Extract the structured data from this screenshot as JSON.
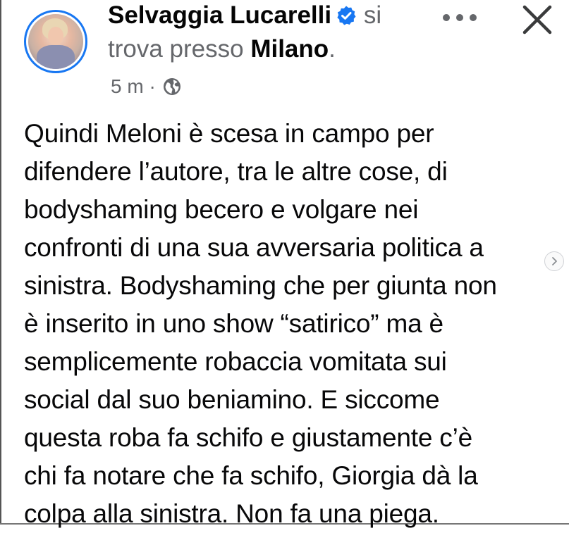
{
  "post": {
    "author_name": "Selvaggia Lucarelli",
    "location_prefix_1": "si",
    "location_prefix_2": "trova presso",
    "location_name": "Milano",
    "location_suffix": ".",
    "time_ago": "5 m",
    "separator": "·",
    "body_text": "Quindi Meloni è scesa in campo per\ndifendere l’autore, tra le altre cose, di\nbodyshaming becero e volgare nei\nconfronti di una sua avversaria politica a\nsinistra. Bodyshaming che per giunta non\nè inserito in uno show “satirico” ma è\nsemplicemente robaccia vomitata sui\nsocial dal suo beniamino. E siccome\nquesta roba fa schifo e giustamente c’è\nchi fa notare che fa schifo, Giorgia dà la\ncolpa alla sinistra. Non fa una piega."
  },
  "icons": {
    "verified": "verified-badge-icon",
    "privacy": "globe-icon",
    "more": "more-dots-icon",
    "close": "close-icon",
    "next": "chevron-right-icon"
  },
  "colors": {
    "accent": "#1877f2",
    "secondary_text": "#65676b",
    "primary_text": "#050505"
  }
}
